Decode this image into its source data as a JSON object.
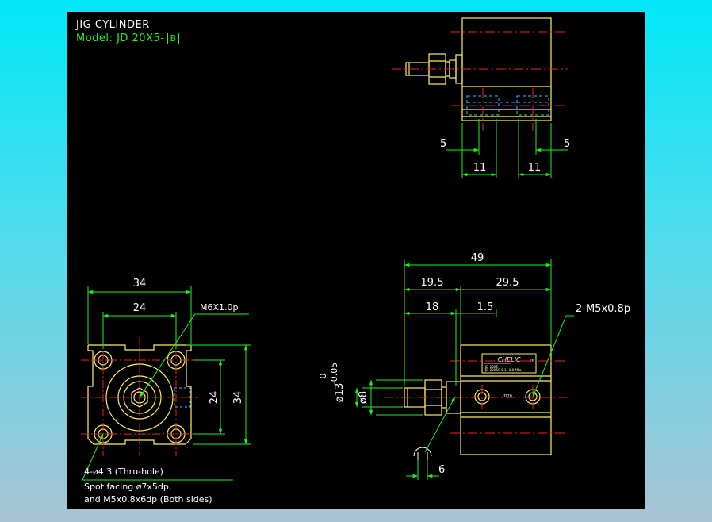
{
  "title": "JIG CYLINDER",
  "model": {
    "prefix": "Model:",
    "code": "JD 20X5-",
    "variant": "B"
  },
  "top_view": {
    "dims": {
      "left_offset": "5",
      "right_offset": "5",
      "left_width": "11",
      "right_width": "11"
    }
  },
  "front_view": {
    "dims": {
      "width_outer": "34",
      "width_inner": "24",
      "height_outer": "34",
      "height_inner": "24",
      "thread": "M6X1.0p"
    },
    "notes": {
      "hole": "4-ø4.3 (Thru-hole)",
      "spot_1": "Spot facing ø7x5dp,",
      "spot_2": "and M5x0.8x6dp (Both sides)"
    }
  },
  "side_view": {
    "dims": {
      "overall": "49",
      "left": "19.5",
      "right": "29.5",
      "rod": "18",
      "gap": "1.5",
      "ports": "2-M5x0.8p",
      "rod_dia": "ø8",
      "collar_dia": "ø13",
      "tol_upper": "0",
      "tol_lower": "-0.05",
      "wrench": "6"
    },
    "label": {
      "brand": "CHELIC",
      "tm": "TM",
      "line1": "JD-20X5",
      "line2": "JD-20X5B 0.1~0.8 MPa",
      "port_mark": "JD20"
    }
  },
  "colors": {
    "background": "#000000",
    "outline": "#ffee66",
    "dimension": "#22ee22",
    "center_line": "#ee2222",
    "hidden_line": "#33bbff",
    "text": "#ffffff"
  }
}
